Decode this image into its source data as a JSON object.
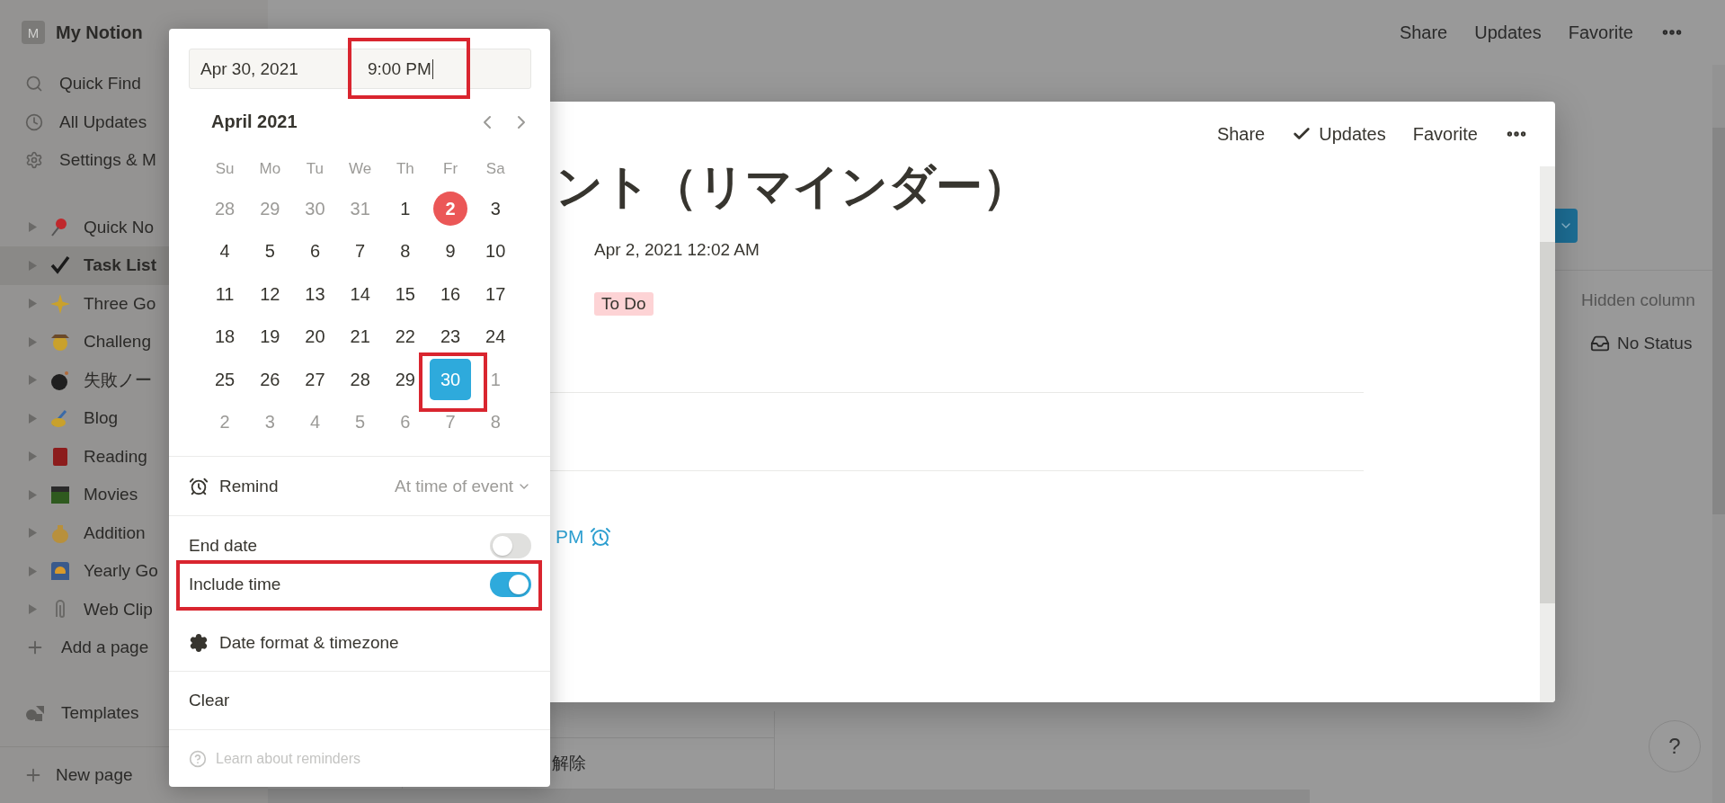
{
  "sidebar": {
    "workspace": {
      "initial": "M",
      "name": "My Notion"
    },
    "nav": [
      {
        "label": "Quick Find"
      },
      {
        "label": "All Updates"
      },
      {
        "label": "Settings & M"
      }
    ],
    "pages": [
      {
        "label": "Quick No",
        "selected": false
      },
      {
        "label": "Task List",
        "selected": true
      },
      {
        "label": "Three Go",
        "selected": false
      },
      {
        "label": "Challeng",
        "selected": false
      },
      {
        "label": "失敗ノー",
        "selected": false
      },
      {
        "label": "Blog",
        "selected": false
      },
      {
        "label": "Reading",
        "selected": false
      },
      {
        "label": "Movies",
        "selected": false
      },
      {
        "label": "Addition",
        "selected": false
      },
      {
        "label": "Yearly Go",
        "selected": false
      },
      {
        "label": "Web Clip",
        "selected": false
      }
    ],
    "add_page": "Add a page",
    "templates": "Templates",
    "new_page": "New page"
  },
  "topbar": {
    "actions": [
      "Share",
      "Updates",
      "Favorite"
    ]
  },
  "board": {
    "hidden_columns": "Hidden column",
    "group": "No Status",
    "cell_text": "解除"
  },
  "modal": {
    "actions": [
      {
        "label": "Share",
        "checked": false
      },
      {
        "label": "Updates",
        "checked": true
      },
      {
        "label": "Favorite",
        "checked": false
      }
    ],
    "title": "ント（リマインダー）",
    "created": "Apr 2, 2021 12:02 AM",
    "status": "To Do",
    "reminder": "PM"
  },
  "date_picker": {
    "date": "Apr 30, 2021",
    "time": "9:00 PM",
    "month": "April 2021",
    "weekdays": [
      "Su",
      "Mo",
      "Tu",
      "We",
      "Th",
      "Fr",
      "Sa"
    ],
    "weeks": [
      [
        {
          "label": "28",
          "muted": true,
          "today": false,
          "selected": false
        },
        {
          "label": "29",
          "muted": true,
          "today": false,
          "selected": false
        },
        {
          "label": "30",
          "muted": true,
          "today": false,
          "selected": false
        },
        {
          "label": "31",
          "muted": true,
          "today": false,
          "selected": false
        },
        {
          "label": "1",
          "muted": false,
          "today": false,
          "selected": false
        },
        {
          "label": "2",
          "muted": false,
          "today": true,
          "selected": false
        },
        {
          "label": "3",
          "muted": false,
          "today": false,
          "selected": false
        }
      ],
      [
        {
          "label": "4",
          "muted": false,
          "today": false,
          "selected": false
        },
        {
          "label": "5",
          "muted": false,
          "today": false,
          "selected": false
        },
        {
          "label": "6",
          "muted": false,
          "today": false,
          "selected": false
        },
        {
          "label": "7",
          "muted": false,
          "today": false,
          "selected": false
        },
        {
          "label": "8",
          "muted": false,
          "today": false,
          "selected": false
        },
        {
          "label": "9",
          "muted": false,
          "today": false,
          "selected": false
        },
        {
          "label": "10",
          "muted": false,
          "today": false,
          "selected": false
        }
      ],
      [
        {
          "label": "11",
          "muted": false,
          "today": false,
          "selected": false
        },
        {
          "label": "12",
          "muted": false,
          "today": false,
          "selected": false
        },
        {
          "label": "13",
          "muted": false,
          "today": false,
          "selected": false
        },
        {
          "label": "14",
          "muted": false,
          "today": false,
          "selected": false
        },
        {
          "label": "15",
          "muted": false,
          "today": false,
          "selected": false
        },
        {
          "label": "16",
          "muted": false,
          "today": false,
          "selected": false
        },
        {
          "label": "17",
          "muted": false,
          "today": false,
          "selected": false
        }
      ],
      [
        {
          "label": "18",
          "muted": false,
          "today": false,
          "selected": false
        },
        {
          "label": "19",
          "muted": false,
          "today": false,
          "selected": false
        },
        {
          "label": "20",
          "muted": false,
          "today": false,
          "selected": false
        },
        {
          "label": "21",
          "muted": false,
          "today": false,
          "selected": false
        },
        {
          "label": "22",
          "muted": false,
          "today": false,
          "selected": false
        },
        {
          "label": "23",
          "muted": false,
          "today": false,
          "selected": false
        },
        {
          "label": "24",
          "muted": false,
          "today": false,
          "selected": false
        }
      ],
      [
        {
          "label": "25",
          "muted": false,
          "today": false,
          "selected": false
        },
        {
          "label": "26",
          "muted": false,
          "today": false,
          "selected": false
        },
        {
          "label": "27",
          "muted": false,
          "today": false,
          "selected": false
        },
        {
          "label": "28",
          "muted": false,
          "today": false,
          "selected": false
        },
        {
          "label": "29",
          "muted": false,
          "today": false,
          "selected": false
        },
        {
          "label": "30",
          "muted": false,
          "today": false,
          "selected": true
        },
        {
          "label": "1",
          "muted": true,
          "today": false,
          "selected": false
        }
      ],
      [
        {
          "label": "2",
          "muted": true,
          "today": false,
          "selected": false
        },
        {
          "label": "3",
          "muted": true,
          "today": false,
          "selected": false
        },
        {
          "label": "4",
          "muted": true,
          "today": false,
          "selected": false
        },
        {
          "label": "5",
          "muted": true,
          "today": false,
          "selected": false
        },
        {
          "label": "6",
          "muted": true,
          "today": false,
          "selected": false
        },
        {
          "label": "7",
          "muted": true,
          "today": false,
          "selected": false
        },
        {
          "label": "8",
          "muted": true,
          "today": false,
          "selected": false
        }
      ]
    ],
    "remind": {
      "label": "Remind",
      "value": "At time of event"
    },
    "toggles": [
      {
        "label": "End date",
        "on": false
      },
      {
        "label": "Include time",
        "on": true
      }
    ],
    "date_format": "Date format & timezone",
    "clear": "Clear",
    "help": "Learn about reminders"
  },
  "help_button": "?"
}
